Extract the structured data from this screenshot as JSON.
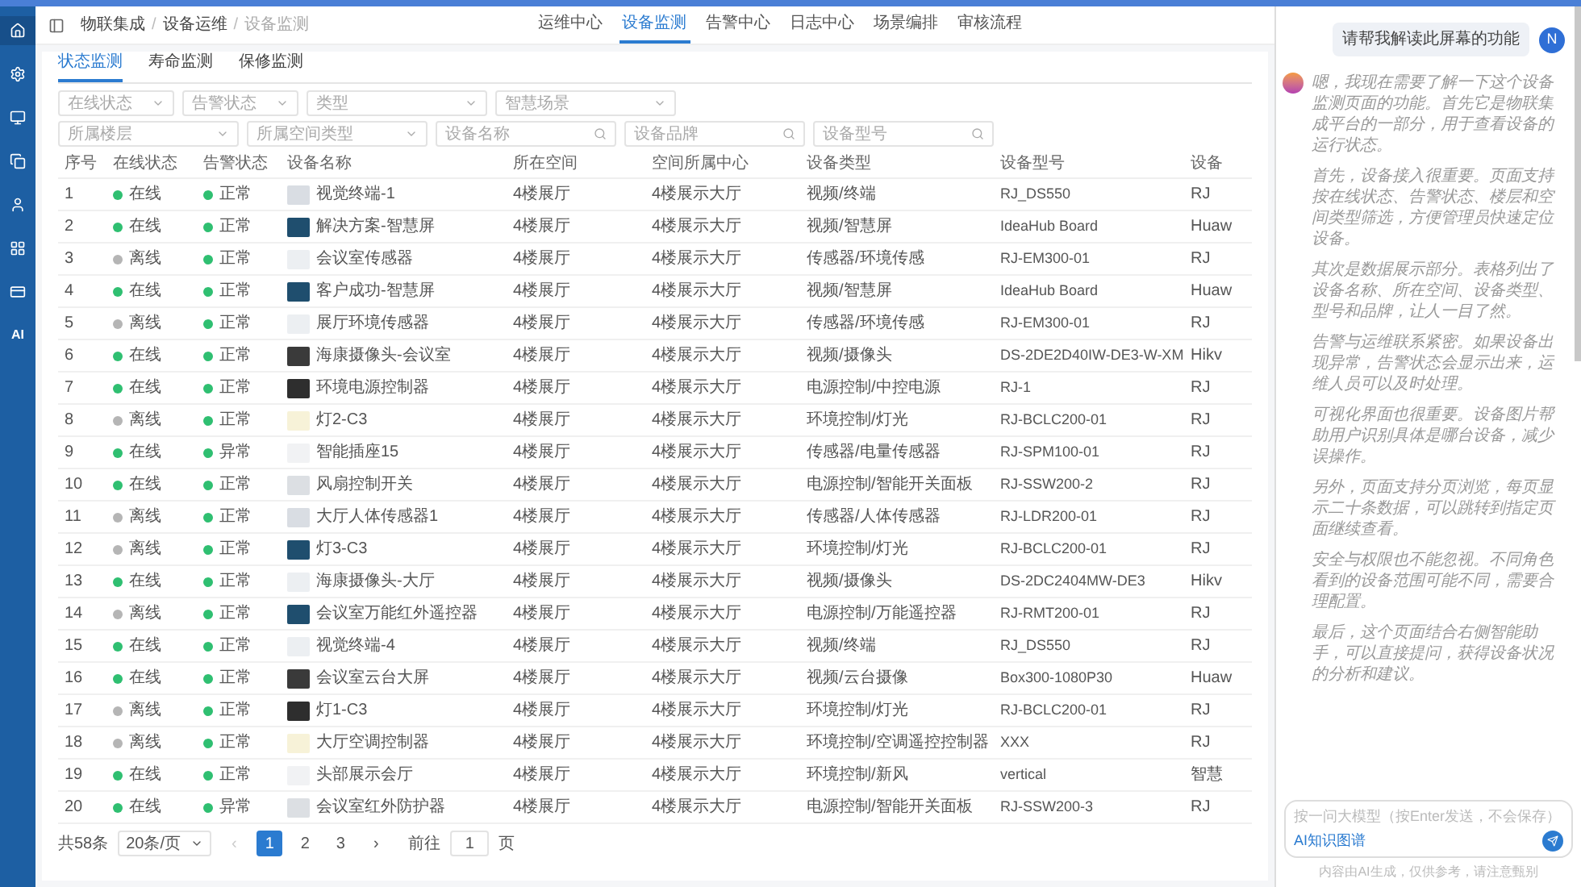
{
  "sidebar": {
    "items": [
      {
        "selected": true
      },
      {
        "selected": false
      },
      {
        "selected": false
      },
      {
        "selected": false
      },
      {
        "selected": false
      },
      {
        "selected": false
      },
      {
        "selected": false
      },
      {
        "label": "AI",
        "selected": false
      }
    ]
  },
  "breadcrumb": [
    {
      "kind": "link",
      "text": "物联集成"
    },
    {
      "kind": "separator",
      "text": "/"
    },
    {
      "kind": "link",
      "text": "设备运维"
    },
    {
      "kind": "separator",
      "text": "/"
    },
    {
      "kind": "current",
      "text": "设备监测"
    }
  ],
  "top_nav": [
    {
      "label": "运维中心",
      "selected": false
    },
    {
      "label": "设备监测",
      "selected": true
    },
    {
      "label": "告警中心",
      "selected": false
    },
    {
      "label": "日志中心",
      "selected": false
    },
    {
      "label": "场景编排",
      "selected": false
    },
    {
      "label": "审核流程",
      "selected": false
    }
  ],
  "tabs": [
    {
      "label": "状态监测",
      "selected": true
    },
    {
      "label": "寿命监测",
      "selected": false
    },
    {
      "label": "保修监测",
      "selected": false
    }
  ],
  "filters": [
    [
      {
        "kind": "select",
        "placeholder": "在线状态"
      },
      {
        "kind": "select",
        "placeholder": "告警状态"
      },
      {
        "kind": "select",
        "placeholder": "类型"
      },
      {
        "kind": "select",
        "placeholder": "智慧场景"
      }
    ],
    [
      {
        "kind": "select",
        "placeholder": "所属楼层"
      },
      {
        "kind": "select",
        "placeholder": "所属空间类型"
      },
      {
        "kind": "search",
        "placeholder": "设备名称"
      },
      {
        "kind": "search",
        "placeholder": "设备品牌"
      },
      {
        "kind": "search",
        "placeholder": "设备型号"
      }
    ]
  ],
  "table": {
    "columns": [
      "序号",
      "在线状态",
      "告警状态",
      "设备名称",
      "所在空间",
      "空间所属中心",
      "设备类型",
      "设备型号",
      "设备"
    ],
    "rows": [
      {
        "no": "1",
        "online": true,
        "online_text": "在线",
        "alarm": "正常",
        "name": "视觉终端-1",
        "space": "4楼展厅",
        "center": "4楼展示大厅",
        "type": "视频/终端",
        "model": "RJ_DS550",
        "brand": "RJ"
      },
      {
        "no": "2",
        "online": true,
        "online_text": "在线",
        "alarm": "正常",
        "name": "解决方案-智慧屏",
        "space": "4楼展厅",
        "center": "4楼展示大厅",
        "type": "视频/智慧屏",
        "model": "IdeaHub Board",
        "brand": "Huaw"
      },
      {
        "no": "3",
        "online": false,
        "online_text": "离线",
        "alarm": "正常",
        "name": "会议室传感器",
        "space": "4楼展厅",
        "center": "4楼展示大厅",
        "type": "传感器/环境传感",
        "model": "RJ-EM300-01",
        "brand": "RJ"
      },
      {
        "no": "4",
        "online": true,
        "online_text": "在线",
        "alarm": "正常",
        "name": "客户成功-智慧屏",
        "space": "4楼展厅",
        "center": "4楼展示大厅",
        "type": "视频/智慧屏",
        "model": "IdeaHub Board",
        "brand": "Huaw"
      },
      {
        "no": "5",
        "online": false,
        "online_text": "离线",
        "alarm": "正常",
        "name": "展厅环境传感器",
        "space": "4楼展厅",
        "center": "4楼展示大厅",
        "type": "传感器/环境传感",
        "model": "RJ-EM300-01",
        "brand": "RJ"
      },
      {
        "no": "6",
        "online": true,
        "online_text": "在线",
        "alarm": "正常",
        "name": "海康摄像头-会议室",
        "space": "4楼展厅",
        "center": "4楼展示大厅",
        "type": "视频/摄像头",
        "model": "DS-2DE2D40IW-DE3-W-XM",
        "brand": "Hikv"
      },
      {
        "no": "7",
        "online": true,
        "online_text": "在线",
        "alarm": "正常",
        "name": "环境电源控制器",
        "space": "4楼展厅",
        "center": "4楼展示大厅",
        "type": "电源控制/中控电源",
        "model": "RJ-1",
        "brand": "RJ"
      },
      {
        "no": "8",
        "online": false,
        "online_text": "离线",
        "alarm": "正常",
        "name": "灯2-C3",
        "space": "4楼展厅",
        "center": "4楼展示大厅",
        "type": "环境控制/灯光",
        "model": "RJ-BCLC200-01",
        "brand": "RJ"
      },
      {
        "no": "9",
        "online": true,
        "online_text": "在线",
        "alarm": "异常",
        "name": "智能插座15",
        "space": "4楼展厅",
        "center": "4楼展示大厅",
        "type": "传感器/电量传感器",
        "model": "RJ-SPM100-01",
        "brand": "RJ"
      },
      {
        "no": "10",
        "online": true,
        "online_text": "在线",
        "alarm": "正常",
        "name": "风扇控制开关",
        "space": "4楼展厅",
        "center": "4楼展示大厅",
        "type": "电源控制/智能开关面板",
        "model": "RJ-SSW200-2",
        "brand": "RJ"
      },
      {
        "no": "11",
        "online": false,
        "online_text": "离线",
        "alarm": "正常",
        "name": "大厅人体传感器1",
        "space": "4楼展厅",
        "center": "4楼展示大厅",
        "type": "传感器/人体传感器",
        "model": "RJ-LDR200-01",
        "brand": "RJ"
      },
      {
        "no": "12",
        "online": false,
        "online_text": "离线",
        "alarm": "正常",
        "name": "灯3-C3",
        "space": "4楼展厅",
        "center": "4楼展示大厅",
        "type": "环境控制/灯光",
        "model": "RJ-BCLC200-01",
        "brand": "RJ"
      },
      {
        "no": "13",
        "online": true,
        "online_text": "在线",
        "alarm": "正常",
        "name": "海康摄像头-大厅",
        "space": "4楼展厅",
        "center": "4楼展示大厅",
        "type": "视频/摄像头",
        "model": "DS-2DC2404MW-DE3",
        "brand": "Hikv"
      },
      {
        "no": "14",
        "online": false,
        "online_text": "离线",
        "alarm": "正常",
        "name": "会议室万能红外遥控器",
        "space": "4楼展厅",
        "center": "4楼展示大厅",
        "type": "电源控制/万能遥控器",
        "model": "RJ-RMT200-01",
        "brand": "RJ"
      },
      {
        "no": "15",
        "online": true,
        "online_text": "在线",
        "alarm": "正常",
        "name": "视觉终端-4",
        "space": "4楼展厅",
        "center": "4楼展示大厅",
        "type": "视频/终端",
        "model": "RJ_DS550",
        "brand": "RJ"
      },
      {
        "no": "16",
        "online": true,
        "online_text": "在线",
        "alarm": "正常",
        "name": "会议室云台大屏",
        "space": "4楼展厅",
        "center": "4楼展示大厅",
        "type": "视频/云台摄像",
        "model": "Box300-1080P30",
        "brand": "Huaw"
      },
      {
        "no": "17",
        "online": false,
        "online_text": "离线",
        "alarm": "正常",
        "name": "灯1-C3",
        "space": "4楼展厅",
        "center": "4楼展示大厅",
        "type": "环境控制/灯光",
        "model": "RJ-BCLC200-01",
        "brand": "RJ"
      },
      {
        "no": "18",
        "online": false,
        "online_text": "离线",
        "alarm": "正常",
        "name": "大厅空调控制器",
        "space": "4楼展厅",
        "center": "4楼展示大厅",
        "type": "环境控制/空调遥控控制器",
        "model": "XXX",
        "brand": "RJ"
      },
      {
        "no": "19",
        "online": true,
        "online_text": "在线",
        "alarm": "正常",
        "name": "头部展示会厅",
        "space": "4楼展厅",
        "center": "4楼展示大厅",
        "type": "环境控制/新风",
        "model": "vertical",
        "brand": "智慧"
      },
      {
        "no": "20",
        "online": true,
        "online_text": "在线",
        "alarm": "异常",
        "name": "会议室红外防护器",
        "space": "4楼展厅",
        "center": "4楼展示大厅",
        "type": "电源控制/智能开关面板",
        "model": "RJ-SSW200-3",
        "brand": "RJ"
      }
    ]
  },
  "pagination": {
    "total": "共58条",
    "page_size": "20条/页",
    "prev": "‹",
    "next": "›",
    "pages": [
      {
        "label": "1",
        "selected": true
      },
      {
        "label": "2",
        "selected": false
      },
      {
        "label": "3",
        "selected": false
      }
    ],
    "goto_label": "前往",
    "goto_value": "1",
    "goto_unit": "页"
  },
  "chat": {
    "user_avatar": "N",
    "user_message": "请帮我解读此屏幕的功能",
    "paragraphs": [
      "嗯，我现在需要了解一下这个设备监测页面的功能。首先它是物联集成平台的一部分，用于查看设备的运行状态。",
      "首先，设备接入很重要。页面支持按在线状态、告警状态、楼层和空间类型筛选，方便管理员快速定位设备。",
      "其次是数据展示部分。表格列出了设备名称、所在空间、设备类型、型号和品牌，让人一目了然。",
      "告警与运维联系紧密。如果设备出现异常，告警状态会显示出来，运维人员可以及时处理。",
      "可视化界面也很重要。设备图片帮助用户识别具体是哪台设备，减少误操作。",
      "另外，页面支持分页浏览，每页显示二十条数据，可以跳转到指定页面继续查看。",
      "安全与权限也不能忽视。不同角色看到的设备范围可能不同，需要合理配置。",
      "最后，这个页面结合右侧智能助手，可以直接提问，获得设备状况的分析和建议。"
    ],
    "input_placeholder": "按一问大模型（按Enter发送，不会保存）",
    "chip": "AI知识图谱",
    "footer": "内容由AI生成，仅供参考，请注意甄别"
  }
}
